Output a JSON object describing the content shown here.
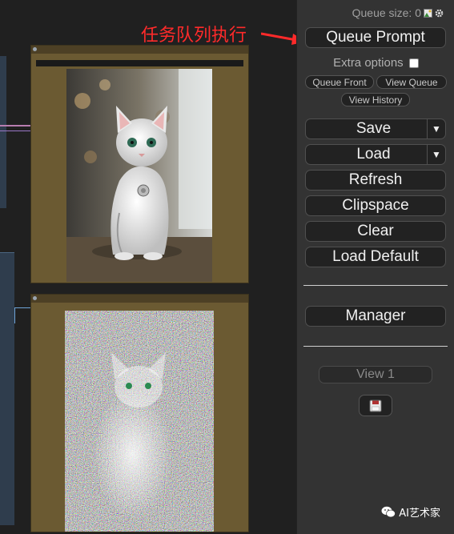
{
  "annotation": {
    "label": "任务队列执行"
  },
  "panel": {
    "queue_size_label": "Queue size: 0",
    "queue_prompt": "Queue Prompt",
    "extra_options": "Extra options",
    "queue_front": "Queue Front",
    "view_queue": "View Queue",
    "view_history": "View History",
    "save": "Save",
    "load": "Load",
    "refresh": "Refresh",
    "clipspace": "Clipspace",
    "clear": "Clear",
    "load_default": "Load Default",
    "manager": "Manager",
    "view1": "View 1"
  },
  "watermark": {
    "text": "AI艺术家"
  },
  "icons": {
    "image_icon": "image-icon",
    "settings_icon": "gear-icon",
    "dropdown": "chevron-down-icon",
    "floppy": "floppy-disk-icon",
    "wechat": "wechat-icon"
  },
  "colors": {
    "annotation": "#ff2a2a",
    "panel_bg": "#333333",
    "button_bg": "#222222",
    "node_body": "#6b5a32"
  }
}
